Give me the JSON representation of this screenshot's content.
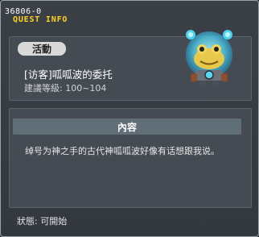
{
  "header": {
    "quest_id": "36806-0",
    "window_title": "QUEST INFO"
  },
  "quest": {
    "tag": "活動",
    "title": "[访客]呱呱波的委托",
    "level": "建議等級: 100~104"
  },
  "npc": {
    "icon": "frog-npc-icon"
  },
  "content": {
    "section_label": "內容",
    "text": "绰号为神之手的古代神呱呱波好像有话想跟我说。"
  },
  "status": {
    "text": "狀態: 可開始"
  },
  "colors": {
    "accent": "#ffd21a",
    "window_bg": "#3a3f46",
    "panel_bg": "#454b53",
    "section_bar": "#606e78"
  }
}
